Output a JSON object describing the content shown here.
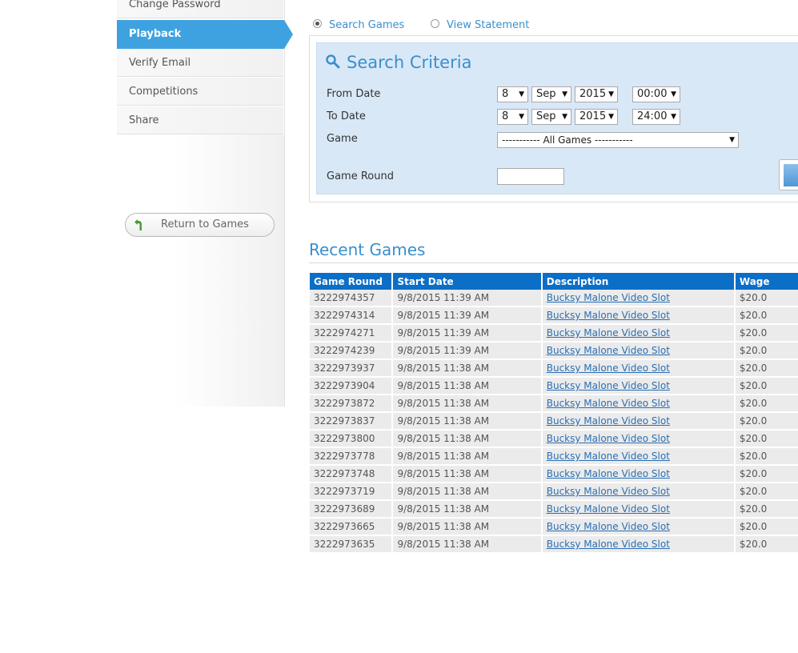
{
  "sidebar": {
    "items": [
      {
        "label": "Change Password"
      },
      {
        "label": "Playback"
      },
      {
        "label": "Verify Email"
      },
      {
        "label": "Competitions"
      },
      {
        "label": "Share"
      }
    ],
    "return_label": "Return to Games"
  },
  "mode": {
    "search_label": "Search Games",
    "statement_label": "View Statement"
  },
  "search": {
    "title": "Search Criteria",
    "from_label": "From Date",
    "to_label": "To Date",
    "game_label": "Game",
    "round_label": "Game Round",
    "from": {
      "day": "8",
      "month": "Sep",
      "year": "2015",
      "time": "00:00"
    },
    "to": {
      "day": "8",
      "month": "Sep",
      "year": "2015",
      "time": "24:00"
    },
    "game_value": "----------- All Games -----------",
    "round_value": ""
  },
  "recent": {
    "title": "Recent Games",
    "columns": [
      "Game Round",
      "Start Date",
      "Description",
      "Wage"
    ],
    "rows": [
      [
        "3222974357",
        "9/8/2015 11:39 AM",
        "Bucksy Malone Video Slot",
        "$20.0"
      ],
      [
        "3222974314",
        "9/8/2015 11:39 AM",
        "Bucksy Malone Video Slot",
        "$20.0"
      ],
      [
        "3222974271",
        "9/8/2015 11:39 AM",
        "Bucksy Malone Video Slot",
        "$20.0"
      ],
      [
        "3222974239",
        "9/8/2015 11:39 AM",
        "Bucksy Malone Video Slot",
        "$20.0"
      ],
      [
        "3222973937",
        "9/8/2015 11:38 AM",
        "Bucksy Malone Video Slot",
        "$20.0"
      ],
      [
        "3222973904",
        "9/8/2015 11:38 AM",
        "Bucksy Malone Video Slot",
        "$20.0"
      ],
      [
        "3222973872",
        "9/8/2015 11:38 AM",
        "Bucksy Malone Video Slot",
        "$20.0"
      ],
      [
        "3222973837",
        "9/8/2015 11:38 AM",
        "Bucksy Malone Video Slot",
        "$20.0"
      ],
      [
        "3222973800",
        "9/8/2015 11:38 AM",
        "Bucksy Malone Video Slot",
        "$20.0"
      ],
      [
        "3222973778",
        "9/8/2015 11:38 AM",
        "Bucksy Malone Video Slot",
        "$20.0"
      ],
      [
        "3222973748",
        "9/8/2015 11:38 AM",
        "Bucksy Malone Video Slot",
        "$20.0"
      ],
      [
        "3222973719",
        "9/8/2015 11:38 AM",
        "Bucksy Malone Video Slot",
        "$20.0"
      ],
      [
        "3222973689",
        "9/8/2015 11:38 AM",
        "Bucksy Malone Video Slot",
        "$20.0"
      ],
      [
        "3222973665",
        "9/8/2015 11:38 AM",
        "Bucksy Malone Video Slot",
        "$20.0"
      ],
      [
        "3222973635",
        "9/8/2015 11:38 AM",
        "Bucksy Malone Video Slot",
        "$20.0"
      ]
    ]
  }
}
